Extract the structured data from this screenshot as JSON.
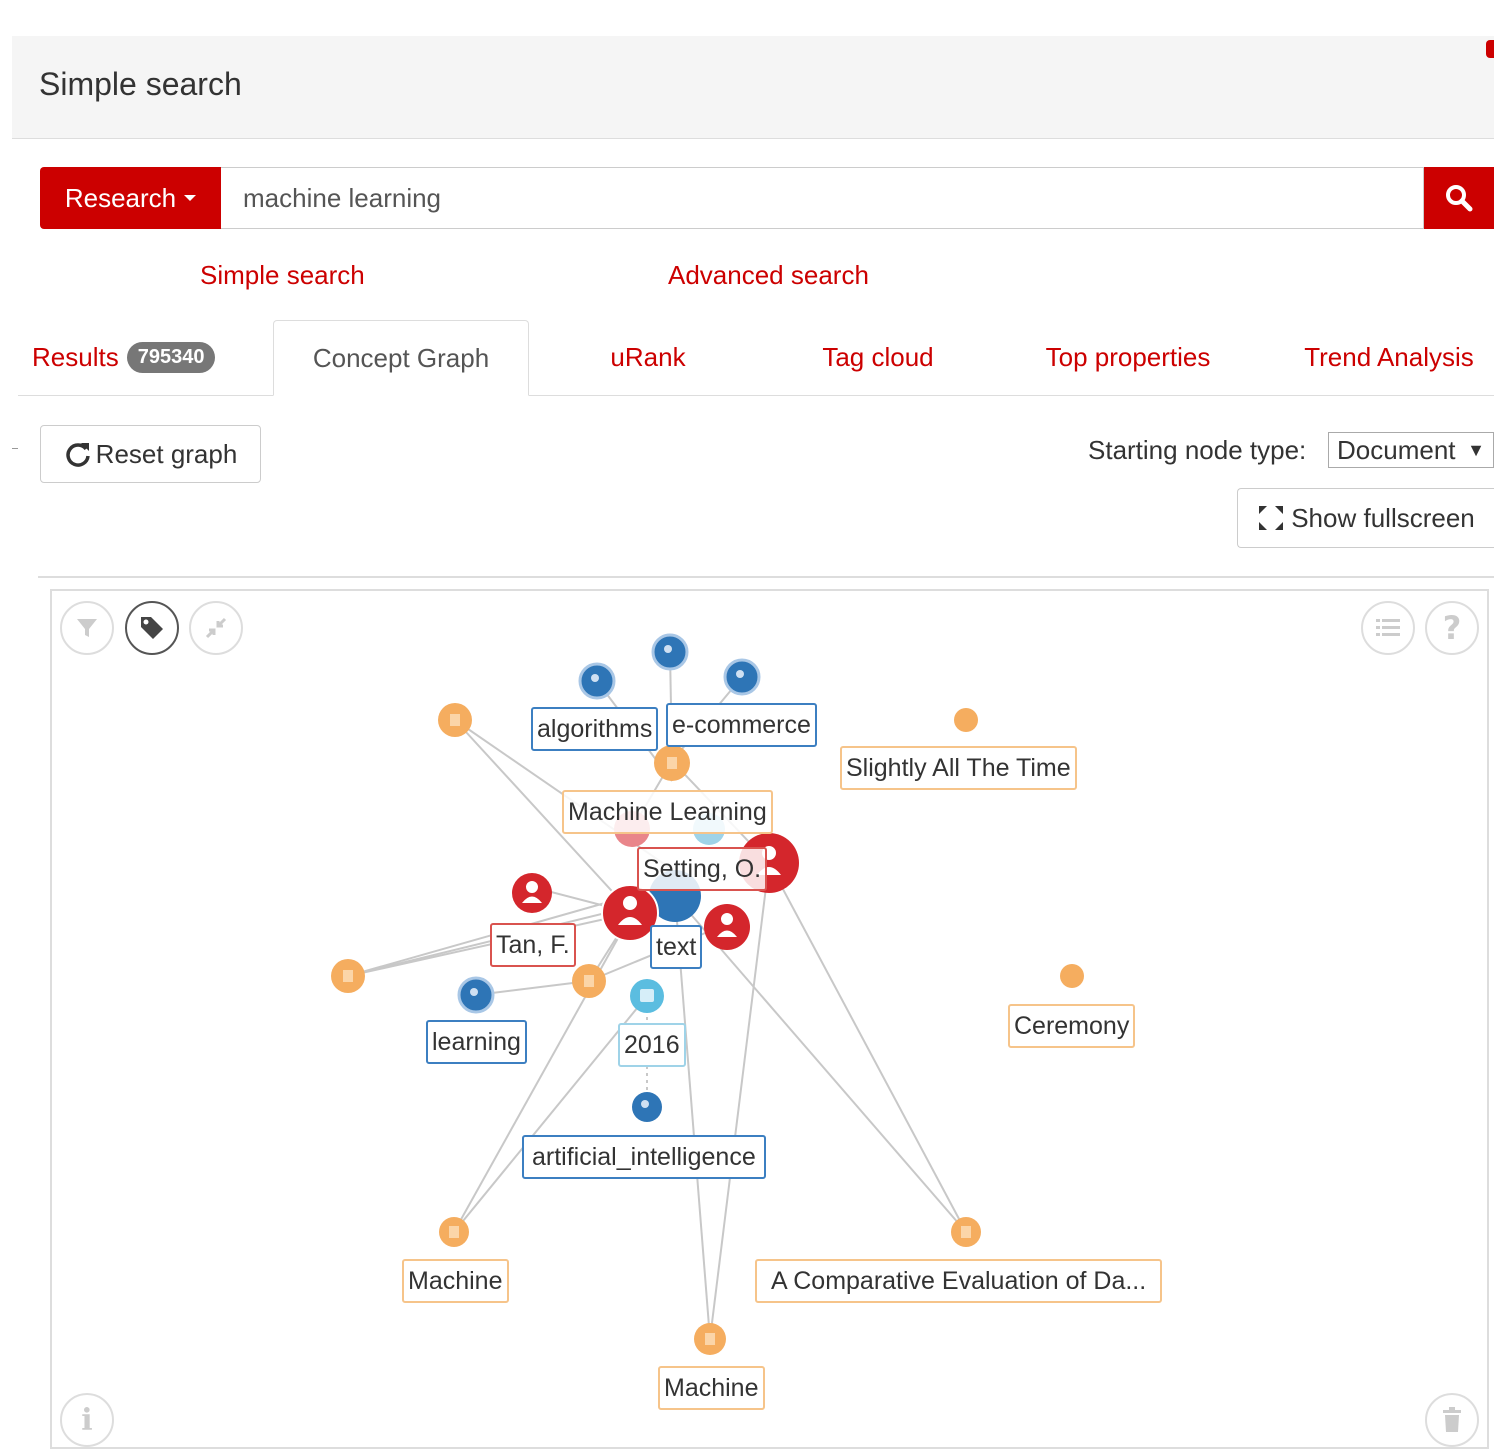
{
  "header": {
    "title": "Simple search"
  },
  "search": {
    "scope_label": "Research",
    "query": "machine learning"
  },
  "links": {
    "simple": "Simple search",
    "advanced": "Advanced search"
  },
  "tabs": [
    {
      "label": "Results",
      "badge": "795340"
    },
    {
      "label": "Concept Graph"
    },
    {
      "label": "uRank"
    },
    {
      "label": "Tag cloud"
    },
    {
      "label": "Top properties"
    },
    {
      "label": "Trend Analysis"
    }
  ],
  "toolbar": {
    "reset_label": "Reset graph",
    "node_type_label": "Starting node type:",
    "node_type_value": "Document",
    "fullscreen_label": "Show fullscreen"
  },
  "graph": {
    "colors": {
      "document": "#f5ad5f",
      "keyword": "#2e75b6",
      "person": "#d4262c",
      "year": "#5bbde0",
      "edge": "#c8c8c8"
    },
    "labels": {
      "algorithms": "algorithms",
      "ecommerce": "e-commerce",
      "slightly": "Slightly All The Time",
      "ml": "Machine Learning",
      "setting": "Setting, O.",
      "tan": "Tan, F.",
      "text": "text",
      "learning": "learning",
      "year": "2016",
      "ceremony": "Ceremony",
      "ai": "artificial_intelligence",
      "machine1": "Machine",
      "comparative": "A Comparative Evaluation of Da...",
      "machine2": "Machine"
    }
  }
}
